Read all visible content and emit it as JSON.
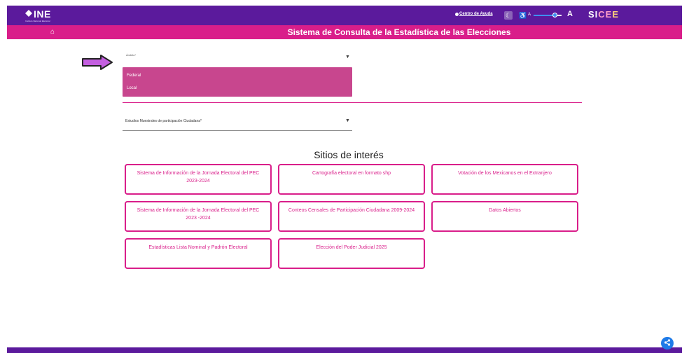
{
  "header": {
    "logo_text": "INE",
    "logo_subtitle": "Instituto Nacional Electoral",
    "help_link": "Centro de Ayuda",
    "font_small": "A",
    "font_large": "A",
    "font_scale_fraction": 0.75,
    "sice_part1": "SI",
    "sice_part2": "CE",
    "sice_part3": "E"
  },
  "title_bar": {
    "title": "Sistema de Consulta de la Estadística de las Elecciones"
  },
  "form": {
    "field1_label": "Ámbito*",
    "field1_options": [
      "Federal",
      "Local"
    ],
    "field2_label": "Estudios Muestrales de participación Ciudadana*"
  },
  "sites": {
    "title": "Sitios de interés",
    "cards": [
      "Sistema de Información de la Jornada Electoral del PEC 2023-2024",
      "Cartografía electoral en formato shp",
      "Votación de los Mexicanos en el Extranjero",
      "Sistema de Información de la Jornada Electoral del PEC 2023 -2024",
      "Conteos Censales de Participación Ciudadana 2009-2024",
      "Datos Abiertos",
      "Estadísticas Lista Nominal y Padrón Electoral",
      "Elección del Poder Judicial 2025"
    ]
  },
  "colors": {
    "header_purple": "#5b1a9c",
    "accent_magenta": "#d91e8a",
    "dropdown_bg": "#c8468e",
    "share_blue": "#1e7be8"
  }
}
